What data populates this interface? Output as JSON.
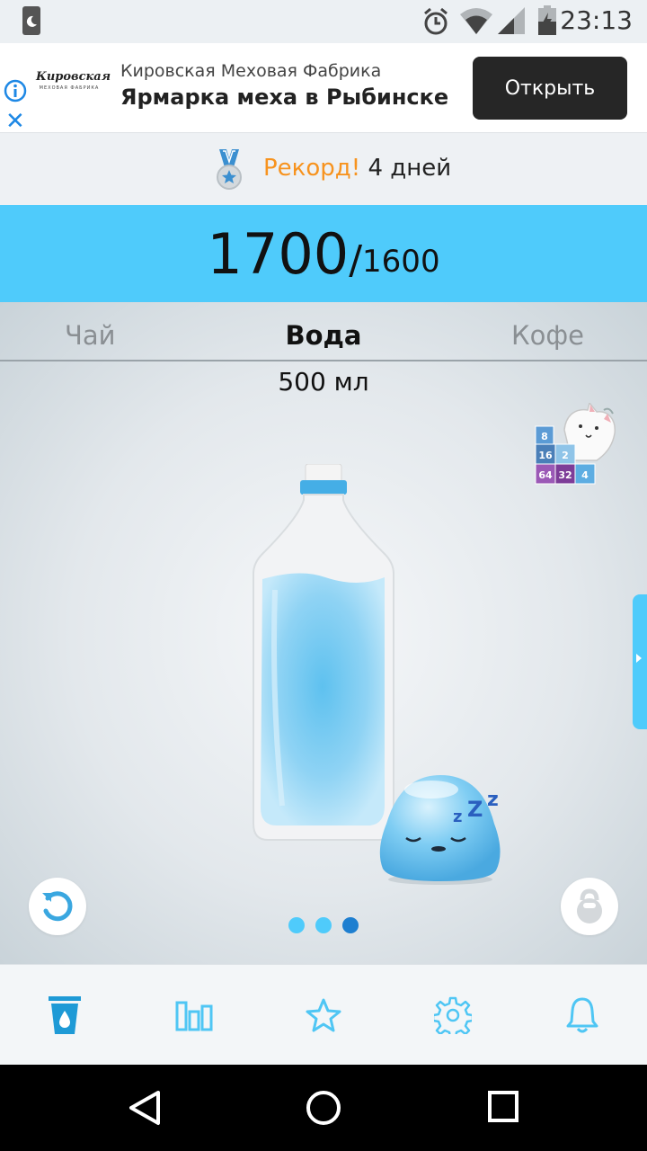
{
  "status_bar": {
    "time": "23:13",
    "icons": [
      "moon-icon",
      "alarm-icon",
      "wifi-icon",
      "signal-icon",
      "battery-icon"
    ]
  },
  "ad": {
    "logo_text": "Кировская",
    "logo_subtext": "МЕХОВАЯ ФАБРИКА",
    "subtitle": "Кировская Меховая Фабрика",
    "title": "Ярмарка меха в Рыбинске",
    "button_label": "Открыть"
  },
  "record": {
    "word": "Рекорд!",
    "days": "4 дней"
  },
  "progress": {
    "current": "1700",
    "slash": "/",
    "goal": "1600"
  },
  "tabs": {
    "tea": "Чай",
    "water": "Вода",
    "coffee": "Кофе",
    "active": "water"
  },
  "volume": "500 мл",
  "promo_tiles": [
    "8",
    "16",
    "2",
    "64",
    "32",
    "4"
  ],
  "pager": {
    "count": 3,
    "active_index": 2
  },
  "bottom_nav": [
    "water-glass-icon",
    "stats-icon",
    "star-icon",
    "settings-gear-icon",
    "bell-icon"
  ],
  "colors": {
    "accent": "#4fcbfb",
    "nav_icon": "#4fc6f4",
    "active_nav_icon": "#1e9ad6",
    "record_orange": "#f7931e"
  }
}
